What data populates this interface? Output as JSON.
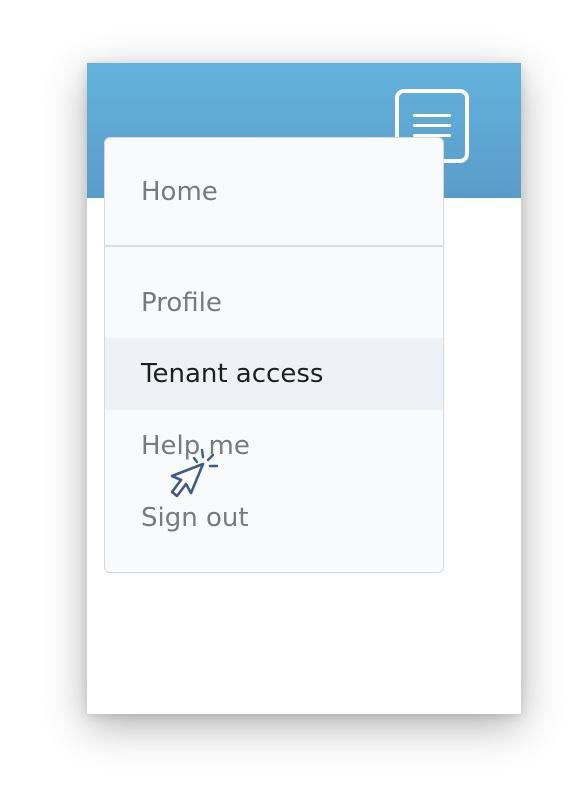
{
  "header": {
    "menu_toggle_icon": "hamburger-menu-icon",
    "gradient_top": "#63b3dd",
    "gradient_bottom": "#5a9cca"
  },
  "menu": {
    "items": [
      {
        "label": "Home"
      },
      {
        "label": "Profile"
      },
      {
        "label": "Tenant access",
        "active": true
      },
      {
        "label": "Help me"
      },
      {
        "label": "Sign out"
      }
    ],
    "active_color": "#eef1f5"
  },
  "cursor": {
    "icon": "pointer-click-icon",
    "color": "#3d5a8c"
  }
}
